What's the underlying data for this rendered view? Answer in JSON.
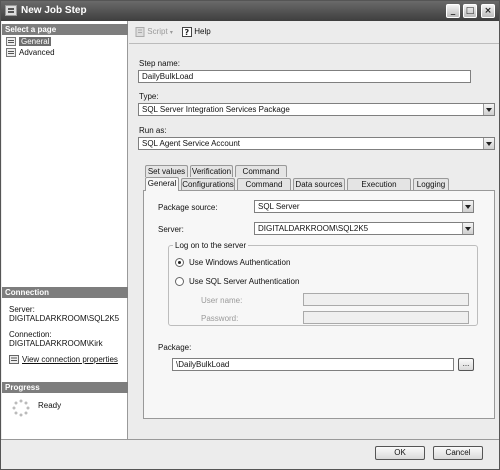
{
  "window": {
    "title": "New Job Step",
    "min": "_",
    "max": "□",
    "close": "×"
  },
  "left": {
    "select_page_header": "Select a page",
    "pages": [
      {
        "label": "General"
      },
      {
        "label": "Advanced"
      }
    ],
    "connection_header": "Connection",
    "server_label": "Server:",
    "server_value": "DIGITALDARKROOM\\SQL2K5",
    "connection_label": "Connection:",
    "connection_value": "DIGITALDARKROOM\\Kirk",
    "view_props_link": "View connection properties",
    "progress_header": "Progress",
    "progress_status": "Ready"
  },
  "toolbar": {
    "script_label": "Script",
    "help_label": "Help"
  },
  "form": {
    "step_name_label": "Step name:",
    "step_name_value": "DailyBulkLoad",
    "type_label": "Type:",
    "type_value": "SQL Server Integration Services Package",
    "run_as_label": "Run as:",
    "run_as_value": "SQL Agent Service Account"
  },
  "tabs": {
    "row1": [
      "Set values",
      "Verification",
      "Command line"
    ],
    "row2": [
      "General",
      "Configurations",
      "Command files",
      "Data sources",
      "Execution options",
      "Logging"
    ],
    "active": "General"
  },
  "general_tab": {
    "package_source_label": "Package source:",
    "package_source_value": "SQL Server",
    "server_label": "Server:",
    "server_value": "DIGITALDARKROOM\\SQL2K5",
    "logon_group_label": "Log on to the server",
    "windows_auth_label": "Use Windows Authentication",
    "sql_auth_label": "Use SQL Server Authentication",
    "auth_selected": "windows",
    "username_label": "User name:",
    "username_value": "",
    "password_label": "Password:",
    "password_value": "",
    "package_label": "Package:",
    "package_value": "\\DailyBulkLoad",
    "browse_label": "..."
  },
  "buttons": {
    "ok_label": "OK",
    "cancel_label": "Cancel"
  }
}
